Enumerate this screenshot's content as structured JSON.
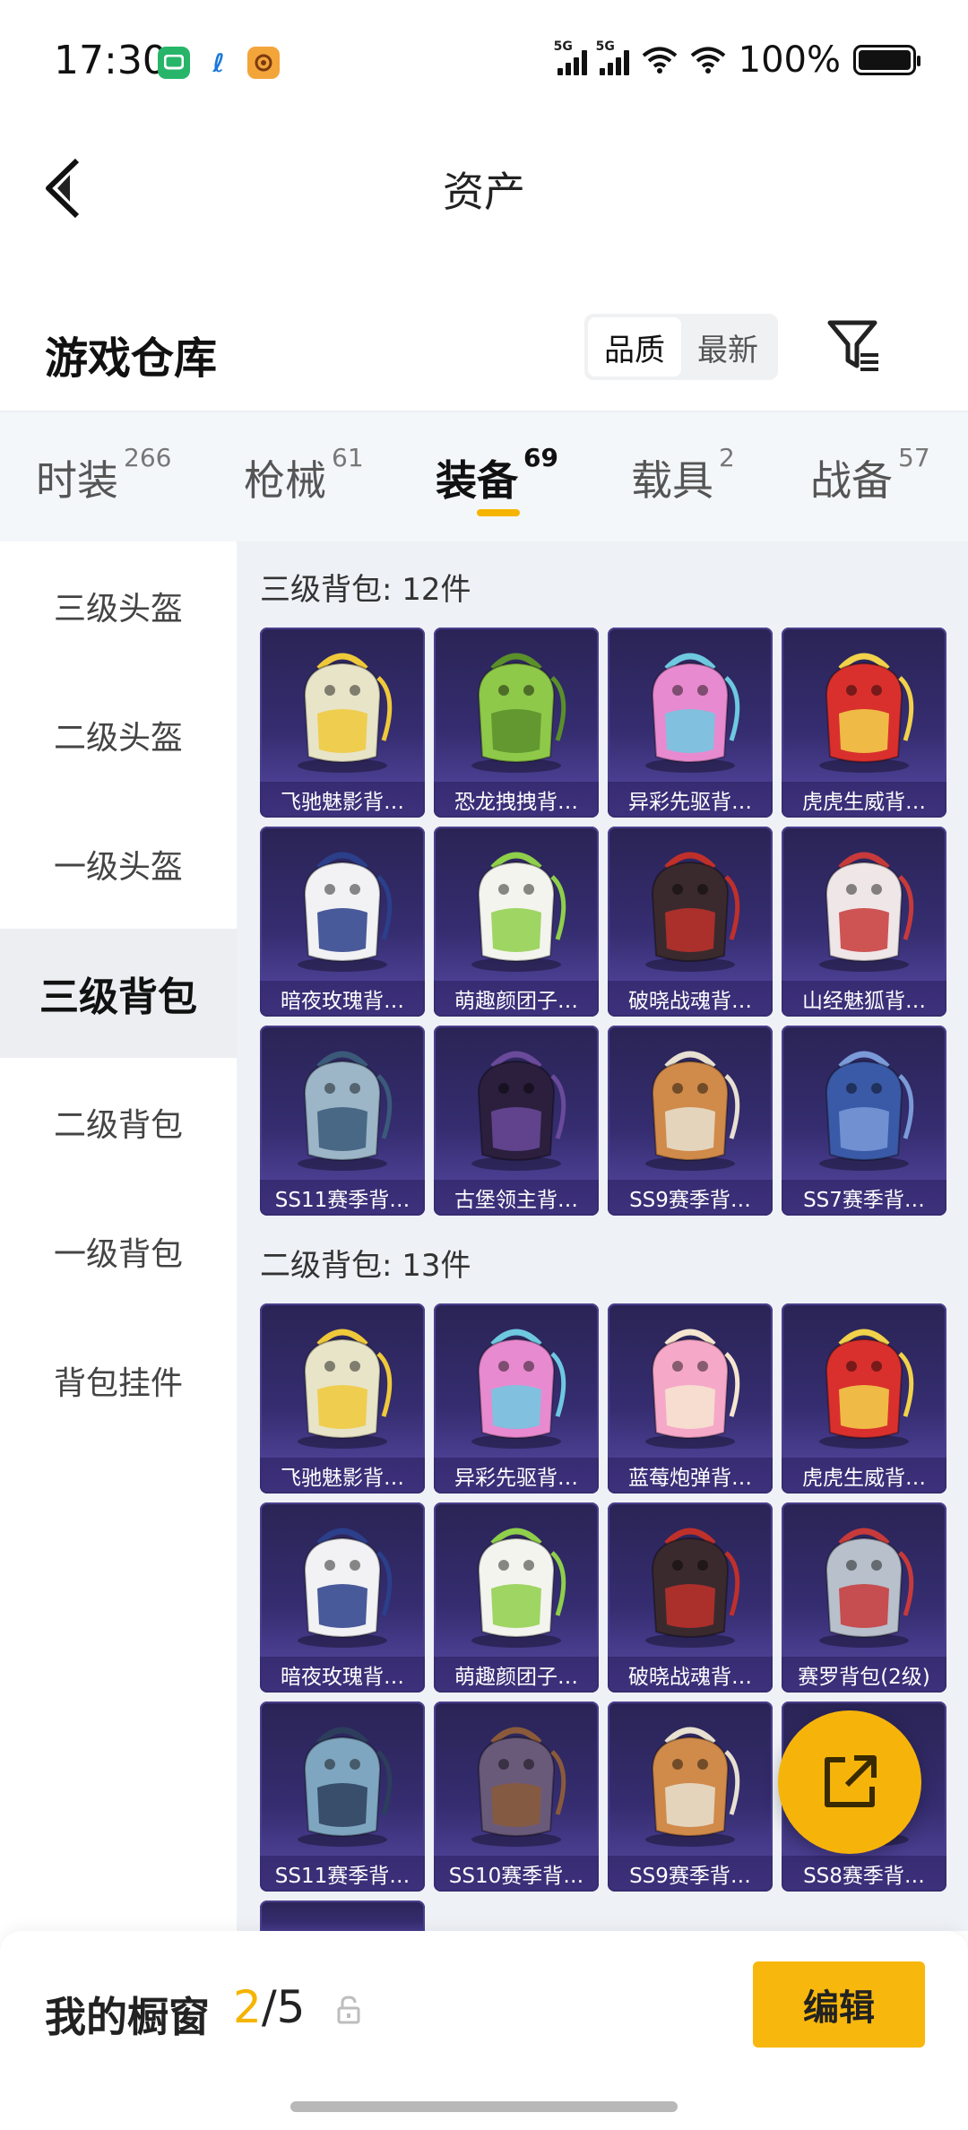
{
  "status_bar": {
    "time": "17:30",
    "network_1": "5G",
    "network_2": "5G",
    "battery": "100%"
  },
  "header": {
    "title": "资产",
    "back_icon": "chevron-left-icon"
  },
  "warehouse": {
    "title": "游戏仓库",
    "sort_options": [
      "品质",
      "最新"
    ],
    "sort_selected": "品质",
    "filter_icon": "filter-icon"
  },
  "tabs": [
    {
      "label": "时装",
      "count": "266"
    },
    {
      "label": "枪械",
      "count": "61"
    },
    {
      "label": "装备",
      "count": "69"
    },
    {
      "label": "载具",
      "count": "2"
    },
    {
      "label": "战备",
      "count": "57"
    }
  ],
  "active_tab": "装备",
  "sidebar": {
    "items": [
      "三级头盔",
      "二级头盔",
      "一级头盔",
      "三级背包",
      "二级背包",
      "一级背包",
      "背包挂件"
    ],
    "active": "三级背包"
  },
  "sections": [
    {
      "title": "三级背包: 12件",
      "items": [
        {
          "name": "飞驰魅影背…",
          "color": "#e8e4c8",
          "accent": "#f0c93a"
        },
        {
          "name": "恐龙拽拽背…",
          "color": "#8fc94a",
          "accent": "#5b8f2a"
        },
        {
          "name": "异彩先驱背…",
          "color": "#e88ad0",
          "accent": "#6ec9e0"
        },
        {
          "name": "虎虎生威背…",
          "color": "#d9302e",
          "accent": "#f2d24a"
        },
        {
          "name": "暗夜玫瑰背…",
          "color": "#f2f2f4",
          "accent": "#2b3f8a"
        },
        {
          "name": "萌趣颜团子…",
          "color": "#f4f4ee",
          "accent": "#8fcf4a"
        },
        {
          "name": "破晓战魂背…",
          "color": "#3a2a2e",
          "accent": "#c0302a"
        },
        {
          "name": "山经魅狐背…",
          "color": "#efe6e8",
          "accent": "#c83a3a"
        },
        {
          "name": "SS11赛季背…",
          "color": "#9cb6c8",
          "accent": "#3b5a7a"
        },
        {
          "name": "古堡领主背…",
          "color": "#2c1f3e",
          "accent": "#6a4a9a"
        },
        {
          "name": "SS9赛季背…",
          "color": "#d08a4a",
          "accent": "#e8e0d0"
        },
        {
          "name": "SS7赛季背…",
          "color": "#3a5aa8",
          "accent": "#7a9ad8"
        }
      ]
    },
    {
      "title": "二级背包: 13件",
      "items": [
        {
          "name": "飞驰魅影背…",
          "color": "#e8e4c8",
          "accent": "#f0c93a"
        },
        {
          "name": "异彩先驱背…",
          "color": "#e88ad0",
          "accent": "#6ec9e0"
        },
        {
          "name": "蓝莓炮弹背…",
          "color": "#f6a8c8",
          "accent": "#f6e6d0"
        },
        {
          "name": "虎虎生威背…",
          "color": "#d9302e",
          "accent": "#f2d24a"
        },
        {
          "name": "暗夜玫瑰背…",
          "color": "#f2f2f4",
          "accent": "#2b3f8a"
        },
        {
          "name": "萌趣颜团子…",
          "color": "#f4f4ee",
          "accent": "#8fcf4a"
        },
        {
          "name": "破晓战魂背…",
          "color": "#3a2a2e",
          "accent": "#c0302a"
        },
        {
          "name": "赛罗背包(2级)",
          "color": "#b8c0cc",
          "accent": "#c83a3a"
        },
        {
          "name": "SS11赛季背…",
          "color": "#7fa6c0",
          "accent": "#2c3e5c"
        },
        {
          "name": "SS10赛季背…",
          "color": "#6a5a7a",
          "accent": "#8a5a3a"
        },
        {
          "name": "SS9赛季背…",
          "color": "#d08a4a",
          "accent": "#e8e0d0"
        },
        {
          "name": "SS8赛季背…",
          "color": "#c04a3a",
          "accent": "#e0a060"
        }
      ]
    }
  ],
  "fab_icon": "share-external-icon",
  "showcase": {
    "label": "我的橱窗",
    "current": "2",
    "separator": "/",
    "total": "5",
    "lock_icon": "lock-icon",
    "edit_label": "编辑"
  }
}
